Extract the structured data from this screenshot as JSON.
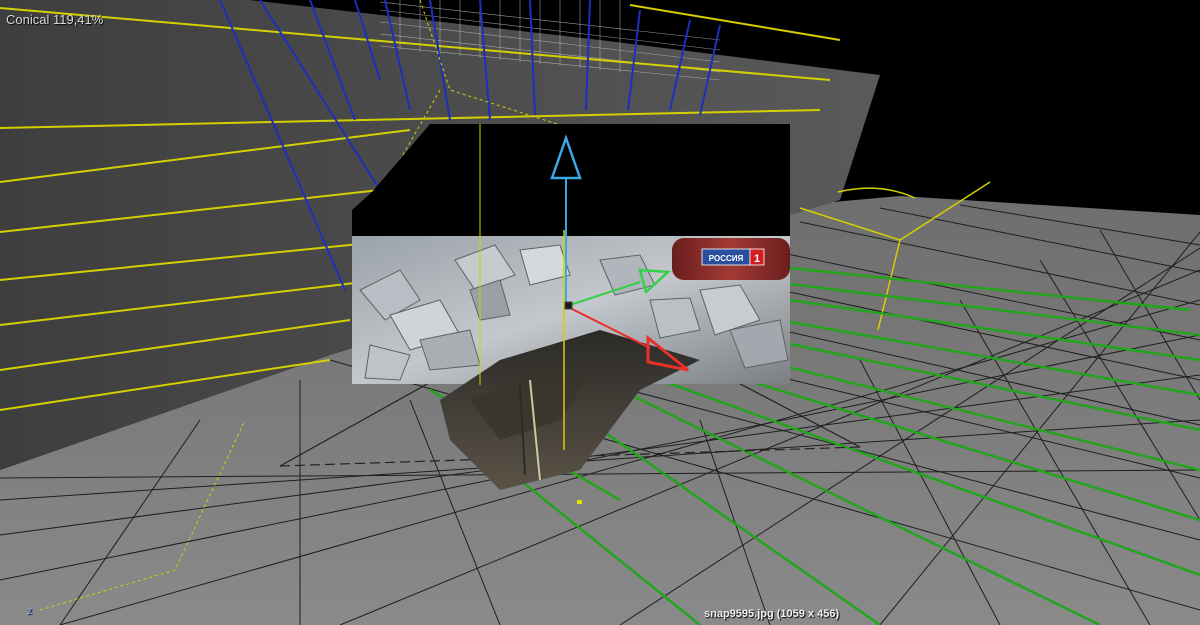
{
  "viewport": {
    "projection_label": "Conical 119,41%",
    "image_info": "snap9595.jpg (1059 x 456)",
    "axis_indicator": "z"
  },
  "overlay_image": {
    "channel_logo_text": "РОССИЯ",
    "channel_logo_number": "1"
  },
  "colors": {
    "background": "#000000",
    "wall": "#4a4a4a",
    "floor": "#7e7e7e",
    "floor_grid": "#1e1e1e",
    "yellow_lines": "#d4d000",
    "blue_lines": "#1c2fbf",
    "green_lines": "#22a51c",
    "gizmo_y": "#3aa8e6",
    "gizmo_x": "#e8302a",
    "gizmo_z": "#33d14a",
    "logo_bg": "#2a4f9e",
    "logo_red": "#d11f1f"
  }
}
